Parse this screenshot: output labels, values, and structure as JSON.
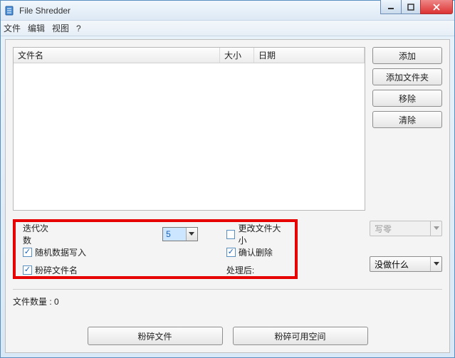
{
  "window": {
    "title": "File Shredder"
  },
  "menubar": {
    "file": "文件",
    "edit": "编辑",
    "view": "视图",
    "help": "?"
  },
  "table": {
    "cols": {
      "name": "文件名",
      "size": "大小",
      "date": "日期"
    }
  },
  "sidebar": {
    "add": "添加",
    "add_folder": "添加文件夹",
    "remove": "移除",
    "clear": "清除"
  },
  "options": {
    "iterations_label": "迭代次数",
    "iterations_value": "5",
    "random_write": "随机数据写入",
    "shred_filename": "粉碎文件名",
    "change_size": "更改文件大小",
    "confirm_delete": "确认删除",
    "after_label": "处理后:",
    "mode_value": "写零",
    "after_value": "没做什么"
  },
  "status": {
    "count_label": "文件数量 : 0"
  },
  "footer": {
    "shred_files": "粉碎文件",
    "shred_free": "粉碎可用空间"
  }
}
